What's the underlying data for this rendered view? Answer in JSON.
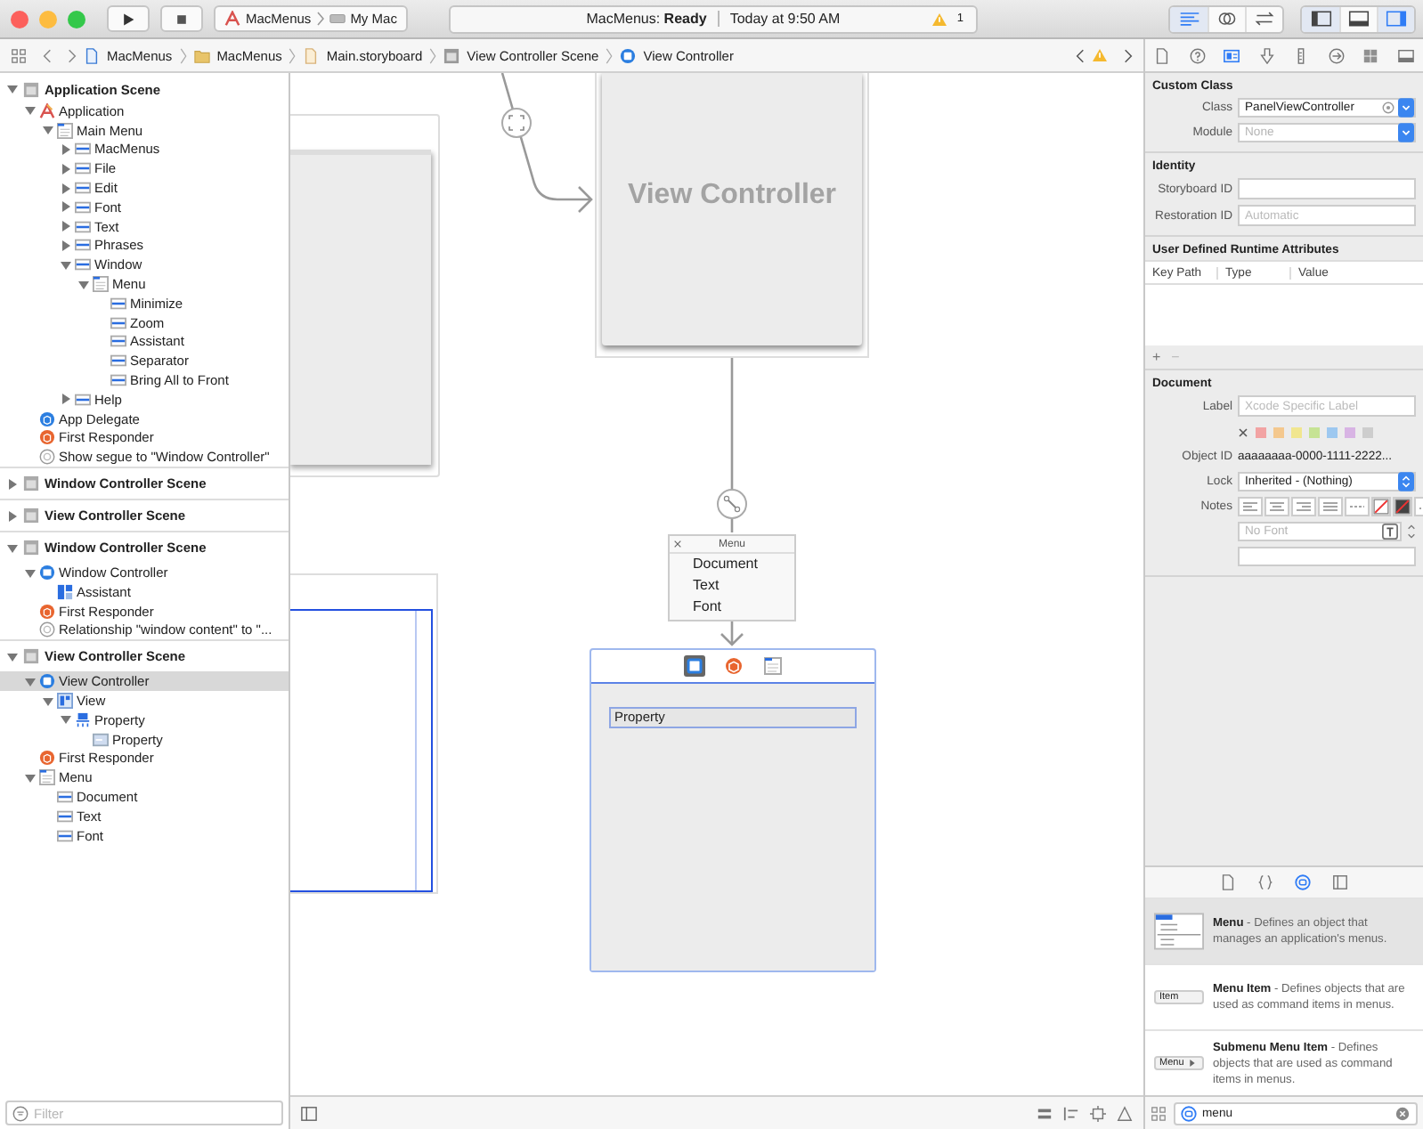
{
  "toolbar": {
    "scheme": "MacMenus",
    "destination": "My Mac",
    "status": "MacMenus: **Ready**",
    "time": "Today at 9:50 AM",
    "warnings": "1",
    "editor_modes": [
      {
        "kind": "standard",
        "selected": true
      },
      {
        "kind": "assistant",
        "selected": false
      },
      {
        "kind": "version",
        "selected": false
      }
    ],
    "panels": [
      {
        "kind": "navigator",
        "selected": true
      },
      {
        "kind": "debug",
        "selected": false
      },
      {
        "kind": "utilities",
        "selected": true
      }
    ]
  },
  "jump_bar": [
    {
      "label": "MacMenus",
      "kind": "project"
    },
    {
      "label": "MacMenus",
      "kind": "folder"
    },
    {
      "label": "Main.storyboard",
      "kind": "storyboard"
    },
    {
      "label": "View Controller Scene",
      "kind": "scene"
    },
    {
      "label": "View Controller",
      "kind": "viewcontroller"
    }
  ],
  "outline": {
    "scenes": [
      {
        "title": "Application Scene",
        "expanded": true,
        "children": [
          {
            "label": "Application",
            "kind": "app",
            "expanded": true,
            "selected": false,
            "children": [
              {
                "label": "Main Menu",
                "kind": "menu",
                "expanded": true,
                "selected": false,
                "children": [
                  {
                    "label": "MacMenus",
                    "kind": "menuitem",
                    "expanded": false,
                    "selected": false
                  },
                  {
                    "label": "File",
                    "kind": "menuitem",
                    "expanded": false,
                    "selected": false
                  },
                  {
                    "label": "Edit",
                    "kind": "menuitem",
                    "expanded": false,
                    "selected": false
                  },
                  {
                    "label": "Font",
                    "kind": "menuitem",
                    "expanded": false,
                    "selected": false
                  },
                  {
                    "label": "Text",
                    "kind": "menuitem",
                    "expanded": false,
                    "selected": false
                  },
                  {
                    "label": "Phrases",
                    "kind": "menuitem",
                    "expanded": false,
                    "selected": false
                  },
                  {
                    "label": "Window",
                    "kind": "menuitem",
                    "expanded": true,
                    "selected": false,
                    "children": [
                      {
                        "label": "Menu",
                        "kind": "menu",
                        "expanded": true,
                        "selected": false,
                        "children": [
                          {
                            "label": "Minimize",
                            "kind": "menuitem",
                            "selected": false
                          },
                          {
                            "label": "Zoom",
                            "kind": "menuitem",
                            "selected": false
                          },
                          {
                            "label": "Assistant",
                            "kind": "menuitem",
                            "selected": false
                          },
                          {
                            "label": "Separator",
                            "kind": "menuitem",
                            "selected": false
                          },
                          {
                            "label": "Bring All to Front",
                            "kind": "menuitem",
                            "selected": false
                          }
                        ]
                      }
                    ]
                  },
                  {
                    "label": "Help",
                    "kind": "menuitem",
                    "expanded": false,
                    "selected": false
                  }
                ]
              }
            ]
          },
          {
            "label": "App Delegate",
            "kind": "delegate",
            "selected": false
          },
          {
            "label": "First Responder",
            "kind": "responder",
            "selected": false
          },
          {
            "label": "Show segue to \"Window Controller\"",
            "kind": "segue",
            "selected": false
          }
        ]
      },
      {
        "title": "Window Controller Scene",
        "expanded": false
      },
      {
        "title": "View Controller Scene",
        "expanded": false
      },
      {
        "title": "Window Controller Scene",
        "expanded": true,
        "children": [
          {
            "label": "Window Controller",
            "kind": "windowcontroller",
            "expanded": true,
            "selected": false,
            "children": [
              {
                "label": "Assistant",
                "kind": "toolbaritem",
                "selected": false
              }
            ]
          },
          {
            "label": "First Responder",
            "kind": "responder",
            "selected": false
          },
          {
            "label": "Relationship \"window content\" to \"...",
            "kind": "segue",
            "selected": false
          }
        ]
      },
      {
        "title": "View Controller Scene",
        "expanded": true,
        "children": [
          {
            "label": "View Controller",
            "kind": "viewcontroller",
            "expanded": true,
            "selected": true,
            "children": [
              {
                "label": "View",
                "kind": "view",
                "expanded": true,
                "selected": false,
                "children": [
                  {
                    "label": "Property",
                    "kind": "property",
                    "expanded": true,
                    "selected": false,
                    "children": [
                      {
                        "label": "Property",
                        "kind": "textfield",
                        "selected": false
                      }
                    ]
                  }
                ]
              }
            ]
          },
          {
            "label": "First Responder",
            "kind": "responder",
            "selected": false
          },
          {
            "label": "Menu",
            "kind": "menu",
            "expanded": true,
            "selected": false,
            "children": [
              {
                "label": "Document",
                "kind": "menuitem",
                "selected": false
              },
              {
                "label": "Text",
                "kind": "menuitem",
                "selected": false
              },
              {
                "label": "Font",
                "kind": "menuitem",
                "selected": false
              }
            ]
          }
        ]
      }
    ],
    "filter": {
      "placeholder": "Filter"
    }
  },
  "canvas": {
    "scene_title": "View Controller",
    "menu": {
      "title": "Menu",
      "items": [
        "Document",
        "Text",
        "Font"
      ]
    },
    "field": "Property"
  },
  "inspector": {
    "tabs": [
      {
        "kind": "file",
        "selected": false
      },
      {
        "kind": "help",
        "selected": false
      },
      {
        "kind": "identity",
        "selected": true
      },
      {
        "kind": "attributes",
        "selected": false
      },
      {
        "kind": "size",
        "selected": false
      },
      {
        "kind": "connections",
        "selected": false
      },
      {
        "kind": "bindings",
        "selected": false
      },
      {
        "kind": "effects",
        "selected": false
      }
    ],
    "custom_class": {
      "title": "Custom Class",
      "class_label": "Class",
      "class_value": "PanelViewController",
      "module_label": "Module",
      "module_placeholder": "None"
    },
    "identity": {
      "title": "Identity",
      "storyboard_label": "Storyboard ID",
      "restoration_label": "Restoration ID",
      "restoration_placeholder": "Automatic"
    },
    "runtime": {
      "title": "User Defined Runtime Attributes",
      "columns": [
        "Key Path",
        "Type",
        "Value"
      ],
      "add": "+",
      "remove": "−"
    },
    "document": {
      "title": "Document",
      "label_label": "Label",
      "label_placeholder": "Xcode Specific Label",
      "colors": [
        {
          "color": "#f2a3a3"
        },
        {
          "color": "#f4c88e"
        },
        {
          "color": "#f1e68f"
        },
        {
          "color": "#c6e394"
        },
        {
          "color": "#9dc8f0"
        },
        {
          "color": "#d8b4e4"
        },
        {
          "color": "#cdcdcd"
        }
      ],
      "object_id_label": "Object ID",
      "object_id": "aaaaaaaa-0000-1111-2222...",
      "lock_label": "Lock",
      "lock_value": "Inherited - (Nothing)",
      "notes_label": "Notes",
      "font_placeholder": "No Font"
    }
  },
  "library": {
    "tabs": [
      {
        "kind": "file",
        "selected": false
      },
      {
        "kind": "code",
        "selected": false
      },
      {
        "kind": "object",
        "selected": true
      },
      {
        "kind": "media",
        "selected": false
      }
    ],
    "items": [
      {
        "kind": "menu",
        "text": "**Menu** - Defines an object that manages an application's menus.",
        "selected": true
      },
      {
        "kind": "item",
        "preview": "Item",
        "text": "**Menu Item** - Defines objects that are used as command items in menus.",
        "selected": false
      },
      {
        "kind": "submenu",
        "preview": "Menu",
        "text": "**Submenu Menu Item** - Defines objects that are used as command items in menus.",
        "selected": false
      }
    ],
    "search": "menu"
  }
}
